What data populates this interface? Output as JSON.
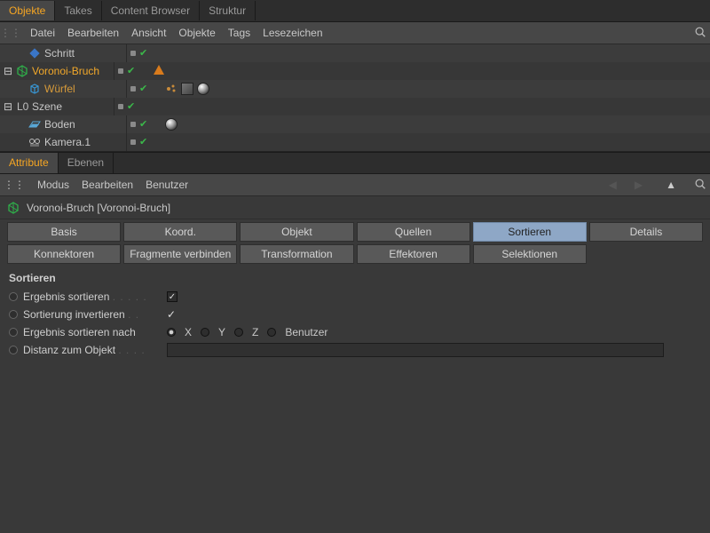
{
  "topTabs": {
    "t0": "Objekte",
    "t1": "Takes",
    "t2": "Content Browser",
    "t3": "Struktur"
  },
  "menu1": {
    "m0": "Datei",
    "m1": "Bearbeiten",
    "m2": "Ansicht",
    "m3": "Objekte",
    "m4": "Tags",
    "m5": "Lesezeichen"
  },
  "tree": {
    "r0": {
      "name": "Schritt"
    },
    "r1": {
      "name": "Voronoi-Bruch"
    },
    "r2": {
      "name": "Würfel"
    },
    "r3": {
      "name": "Szene"
    },
    "r4": {
      "name": "Boden"
    },
    "r5": {
      "name": "Kamera.1"
    }
  },
  "attrTabs": {
    "t0": "Attribute",
    "t1": "Ebenen"
  },
  "menu2": {
    "m0": "Modus",
    "m1": "Bearbeiten",
    "m2": "Benutzer"
  },
  "objectTitle": "Voronoi-Bruch [Voronoi-Bruch]",
  "subtabs": {
    "s0": "Basis",
    "s1": "Koord.",
    "s2": "Objekt",
    "s3": "Quellen",
    "s4": "Sortieren",
    "s5": "Details",
    "s6": "Konnektoren",
    "s7": "Fragmente verbinden",
    "s8": "Transformation",
    "s9": "Effektoren",
    "s10": "Selektionen"
  },
  "section": "Sortieren",
  "props": {
    "p0": "Ergebnis sortieren",
    "p1": "Sortierung invertieren",
    "p2": "Ergebnis sortieren nach",
    "p3": "Distanz zum Objekt"
  },
  "radios": {
    "x": "X",
    "y": "Y",
    "z": "Z",
    "user": "Benutzer"
  }
}
